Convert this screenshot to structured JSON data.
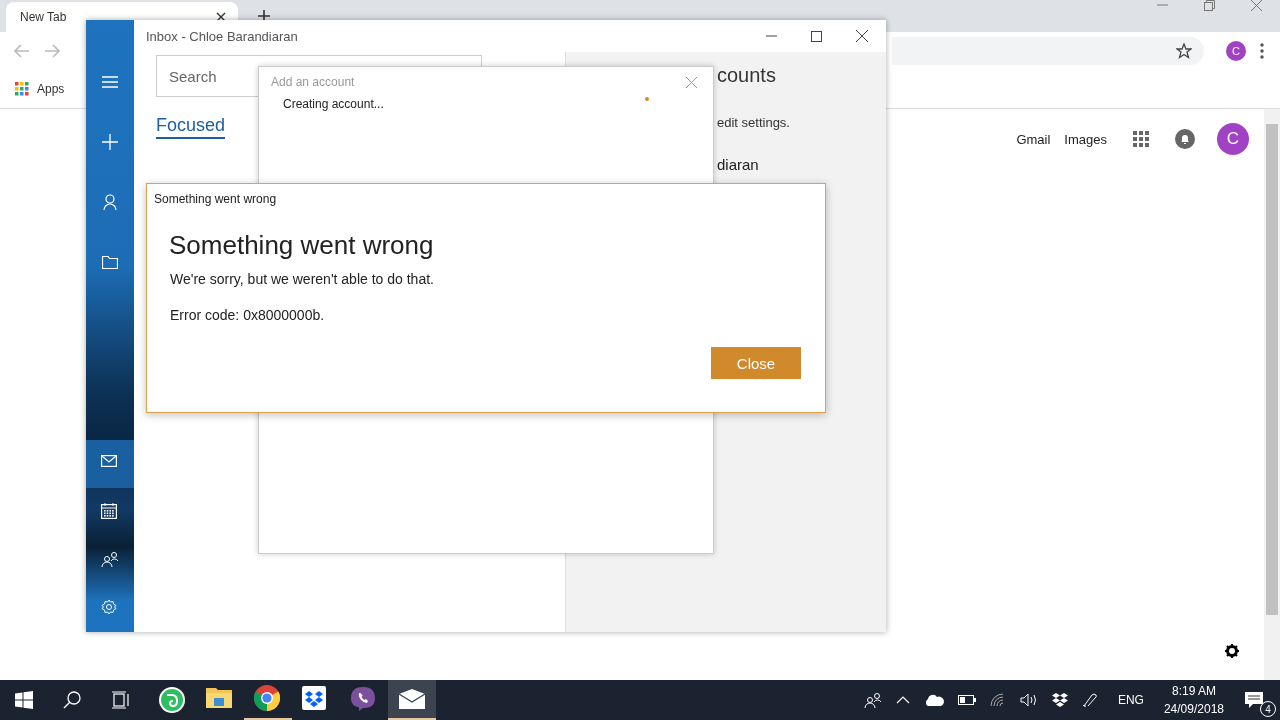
{
  "browser": {
    "tab_title": "New Tab",
    "bookmarks": [
      {
        "label": "Apps"
      }
    ],
    "profile_letter": "C",
    "header_links": [
      "Gmail",
      "Images"
    ],
    "account_letter": "C"
  },
  "mail_window": {
    "title": "Inbox - Chloe Barandiaran",
    "search": {
      "placeholder": "Search"
    },
    "tabs": [
      {
        "label": "Focused",
        "selected": true
      }
    ],
    "nav_top": [
      {
        "kind": "menu"
      },
      {
        "kind": "compose"
      },
      {
        "kind": "accounts"
      },
      {
        "kind": "folders"
      }
    ],
    "nav_bottom": [
      {
        "kind": "mail",
        "selected": true
      },
      {
        "kind": "calendar",
        "selected": false
      },
      {
        "kind": "people",
        "selected": false
      },
      {
        "kind": "settings",
        "selected": false
      }
    ],
    "accounts_pane": {
      "heading": "counts",
      "hint": "edit settings.",
      "account": "diaran"
    }
  },
  "add_account_dialog": {
    "title": "Add an account",
    "status": "Creating account..."
  },
  "error_dialog": {
    "title": "Something went wrong",
    "heading": "Something went wrong",
    "message": "We're sorry, but we weren't able to do that.",
    "error_code": "Error code: 0x8000000b.",
    "button": "Close"
  },
  "taskbar": {
    "apps": [
      {
        "kind": "evernote",
        "running": false,
        "selected": false
      },
      {
        "kind": "explorer",
        "running": false,
        "selected": false
      },
      {
        "kind": "chrome",
        "running": true,
        "selected": false
      },
      {
        "kind": "dropbox",
        "running": false,
        "selected": false
      },
      {
        "kind": "viber",
        "running": false,
        "selected": false
      },
      {
        "kind": "mail",
        "running": true,
        "selected": true
      }
    ],
    "language": "ENG",
    "time": "8:19 AM",
    "date": "24/09/2018",
    "notifications": "4"
  }
}
